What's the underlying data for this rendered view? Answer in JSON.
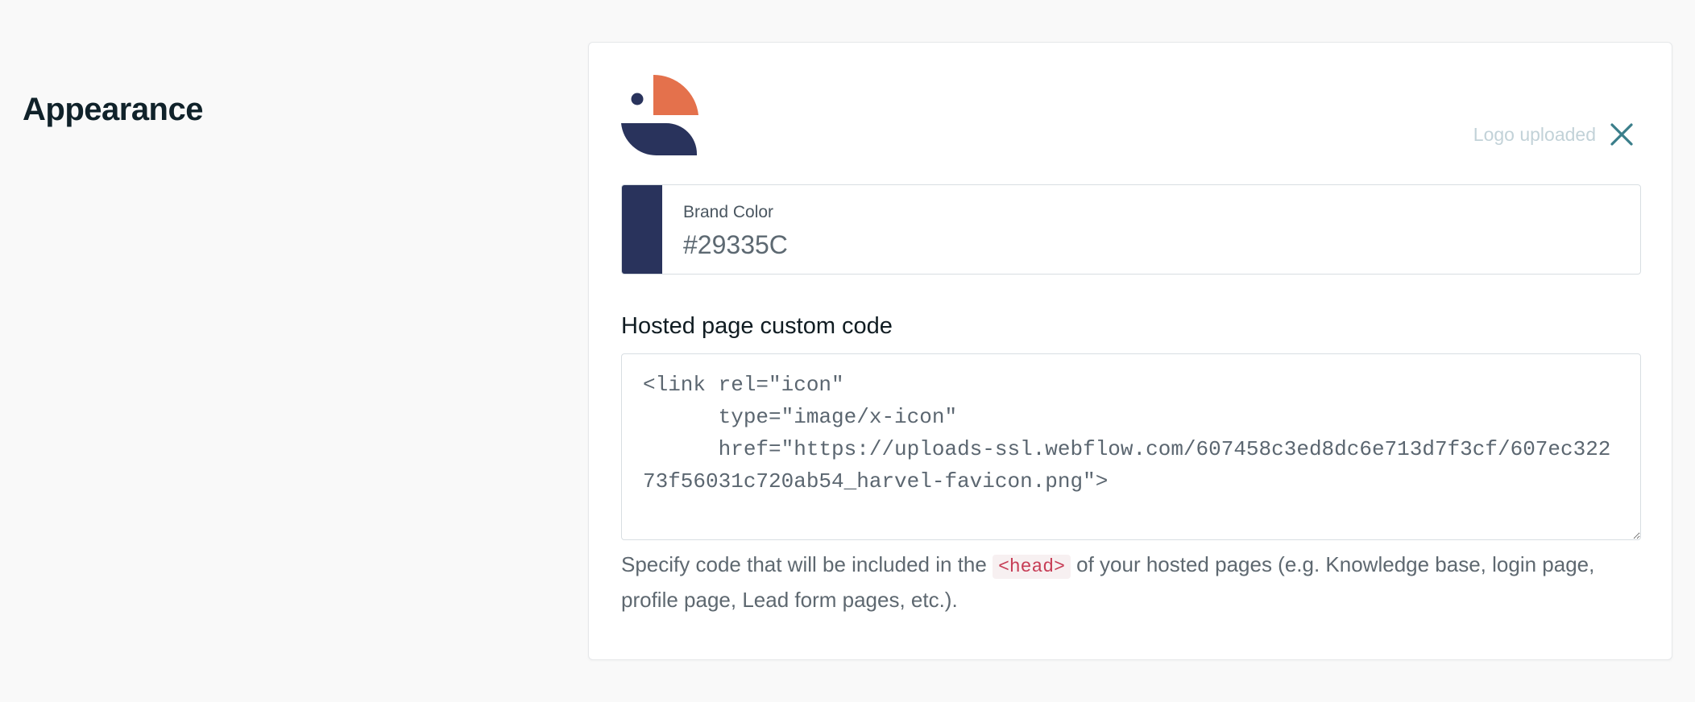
{
  "page": {
    "heading": "Appearance"
  },
  "logo": {
    "icon": "parrot-logo-icon",
    "status_text": "Logo uploaded",
    "remove_icon": "close-icon",
    "colors": {
      "orange": "#E4714C",
      "navy": "#29335C"
    }
  },
  "brand_color": {
    "label": "Brand Color",
    "value": "#29335C",
    "swatch": "#29335C"
  },
  "custom_code": {
    "title": "Hosted page custom code",
    "value": "<link rel=\"icon\"\n      type=\"image/x-icon\"\n      href=\"https://uploads-ssl.webflow.com/607458c3ed8dc6e713d7f3cf/607ec32273f56031c720ab54_harvel-favicon.png\">",
    "help_before": "Specify code that will be included in the ",
    "help_code": "<head>",
    "help_after": " of your hosted pages (e.g. Knowledge base, login page, profile page, Lead form pages, etc.)."
  },
  "colors": {
    "page_bg": "#F9F9F9",
    "heading": "#10222A",
    "close_icon": "#3A7E8A",
    "status_text": "#C2D2D8",
    "code_highlight": "#C73D56"
  }
}
